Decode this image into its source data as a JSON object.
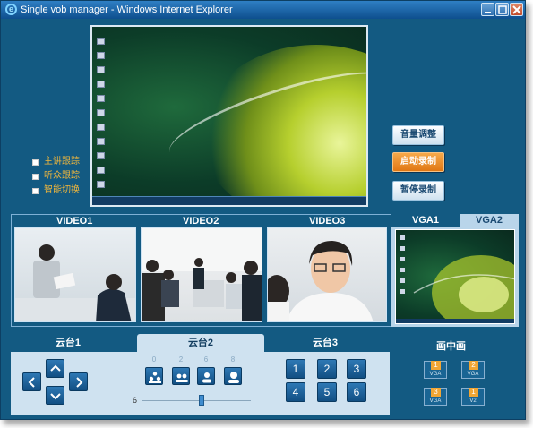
{
  "window": {
    "title": "Single vob manager - Windows Internet Explorer"
  },
  "checkboxes": [
    {
      "label": "主讲跟踪"
    },
    {
      "label": "听众跟踪"
    },
    {
      "label": "智能切换"
    }
  ],
  "side_buttons": [
    {
      "label": "音量调整"
    },
    {
      "label": "启动录制"
    },
    {
      "label": "暂停录制"
    }
  ],
  "video_labels": [
    "VIDEO1",
    "VIDEO2",
    "VIDEO3"
  ],
  "vga_tabs": [
    "VGA1",
    "VGA2"
  ],
  "ptz_tabs": [
    "云台1",
    "云台2",
    "云台3"
  ],
  "ptz_preset_numbers": [
    "0",
    "2",
    "6",
    "8"
  ],
  "number_buttons": [
    "1",
    "2",
    "3",
    "4",
    "5",
    "6"
  ],
  "slider": {
    "label": "6",
    "value_fraction": 0.55
  },
  "pip": {
    "title": "画中画",
    "buttons": [
      {
        "num": "1",
        "label": "VGA"
      },
      {
        "num": "2",
        "label": "VGA"
      },
      {
        "num": "3",
        "label": "VGA"
      },
      {
        "num": "1",
        "label": "V2"
      }
    ]
  },
  "colors": {
    "accent_orange": "#e07714",
    "panel_blue": "#135a82"
  }
}
